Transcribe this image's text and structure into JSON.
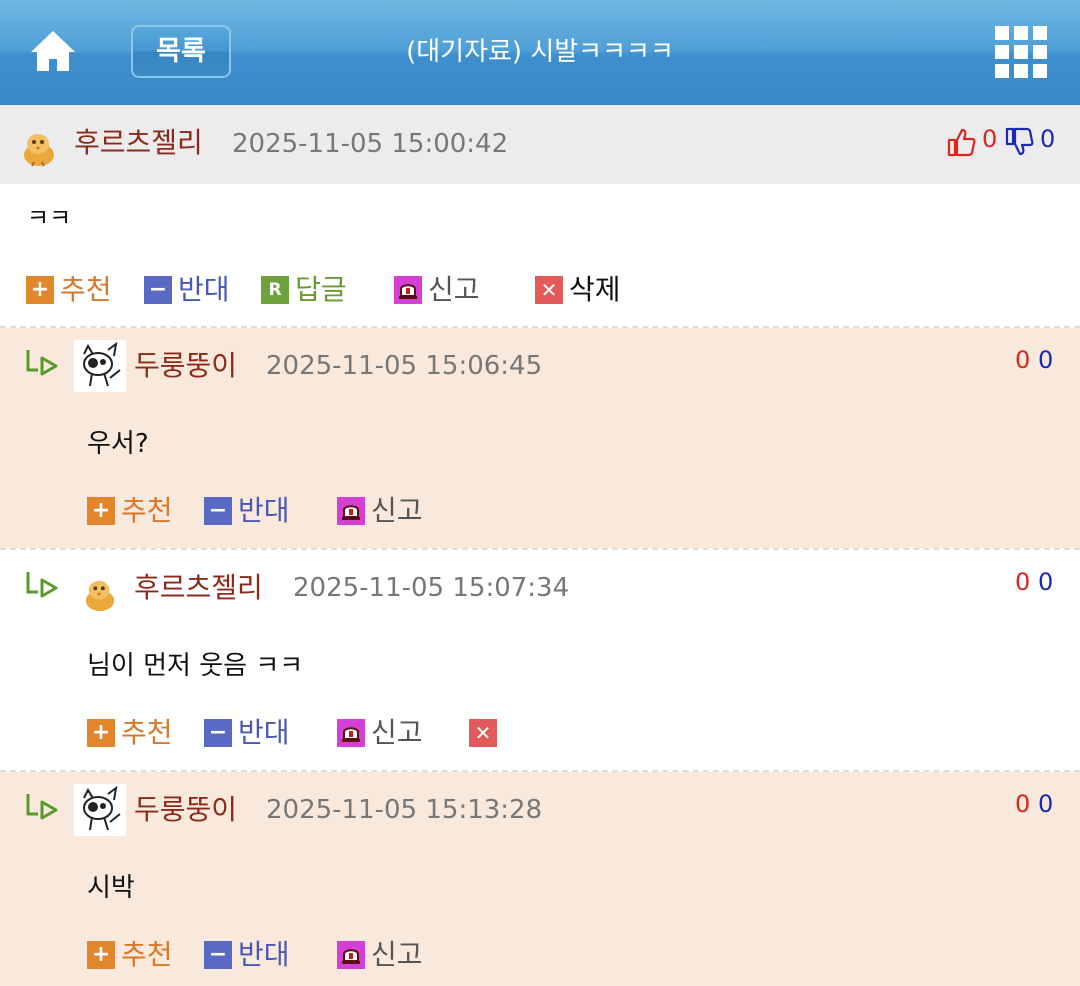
{
  "header": {
    "list_label": "목록",
    "title": "(대기자료) 시발ㅋㅋㅋㅋ"
  },
  "post": {
    "author": "후르츠젤리",
    "date": "2025-11-05 15:00:42",
    "likes": "0",
    "dislikes": "0",
    "body": "ㅋㅋ",
    "actions": {
      "recommend": "추천",
      "oppose": "반대",
      "reply": "답글",
      "report": "신고",
      "delete": "삭제"
    }
  },
  "comments": [
    {
      "author": "두룽뚱이",
      "date": "2025-11-05 15:06:45",
      "likes": "0",
      "dislikes": "0",
      "text": "우서?",
      "actions": {
        "recommend": "추천",
        "oppose": "반대",
        "report": "신고"
      }
    },
    {
      "author": "후르츠젤리",
      "date": "2025-11-05 15:07:34",
      "likes": "0",
      "dislikes": "0",
      "text": "님이 먼저 웃음 ㅋㅋ",
      "actions": {
        "recommend": "추천",
        "oppose": "반대",
        "report": "신고"
      }
    },
    {
      "author": "두룽뚱이",
      "date": "2025-11-05 15:13:28",
      "likes": "0",
      "dislikes": "0",
      "text": "시박",
      "actions": {
        "recommend": "추천",
        "oppose": "반대",
        "report": "신고"
      }
    }
  ],
  "icons": {
    "home": "home-icon",
    "menu": "grid-menu-icon",
    "like": "thumbs-up-icon",
    "dislike": "thumbs-down-icon",
    "reply_arrow": "reply-arrow-icon",
    "report": "siren-icon",
    "delete": "close-icon"
  },
  "colors": {
    "topbar": "#4f9fd6",
    "author": "#8b2a1a",
    "like": "#d8281c",
    "dislike": "#1c2ab0",
    "comment_bg": "#f8e9dc"
  }
}
